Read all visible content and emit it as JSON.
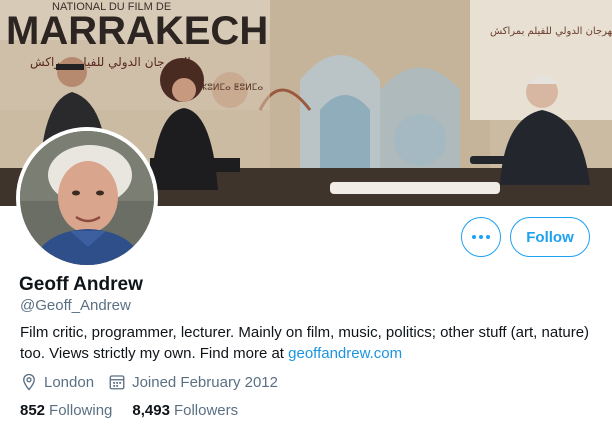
{
  "banner": {
    "title_text": "MARRAKECH",
    "subtitle_text": "NATIONAL DU FILM DE",
    "right_arabic_text": "المهرجان الدولي للفيلم بمراكش",
    "left_arabic_text": "المهرجان الدولي للفيلم بمراكش",
    "small_text": "ⵣⵓⵍⵎⴰ ⵟⵓⵍⵎⴰ"
  },
  "profile": {
    "name": "Geoff Andrew",
    "handle": "@Geoff_Andrew",
    "bio_text": "Film critic, programmer, lecturer. Mainly on film, music, politics; other stuff (art, nature) too. Views strictly my own. Find more at ",
    "bio_link": "geoffandrew.com",
    "location": "London",
    "joined": "Joined February 2012",
    "following_count": "852",
    "following_label": "Following",
    "followers_count": "8,493",
    "followers_label": "Followers"
  },
  "actions": {
    "follow_label": "Follow",
    "more_icon": "more-horizontal-icon"
  },
  "icons": {
    "location": "location-pin-icon",
    "calendar": "calendar-icon"
  },
  "colors": {
    "accent": "#1da1f2",
    "link": "#1b95e0",
    "secondary_text": "#5b7083",
    "primary_text": "#0f1419"
  }
}
